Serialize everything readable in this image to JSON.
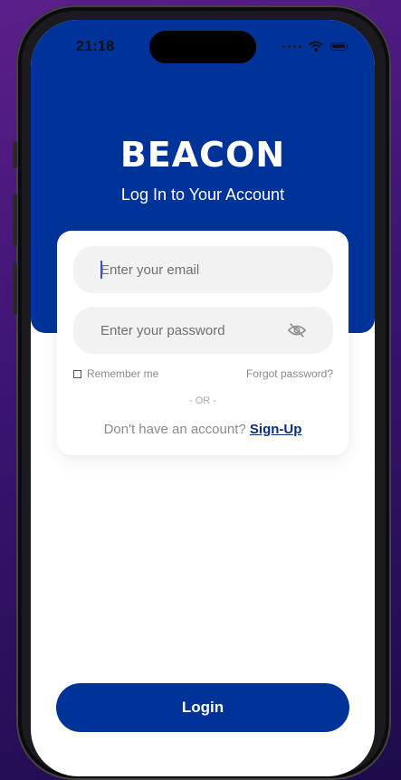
{
  "status_bar": {
    "time": "21:18"
  },
  "header": {
    "logo_text": "BEACON",
    "subtitle": "Log In to Your Account"
  },
  "form": {
    "email_placeholder": "Enter your email",
    "password_placeholder": "Enter your password",
    "password_toggle_icon": "eye-off-icon",
    "remember_label": "Remember me",
    "forgot_label": "Forgot password?",
    "divider_text": "- OR -",
    "signup_prompt": "Don't have an account?",
    "signup_link": "Sign-Up"
  },
  "login_button": "Login",
  "colors": {
    "brand": "#003399",
    "field_bg": "#f2f2f2",
    "muted_text": "#8a8a8a",
    "link": "#0a2d80"
  }
}
